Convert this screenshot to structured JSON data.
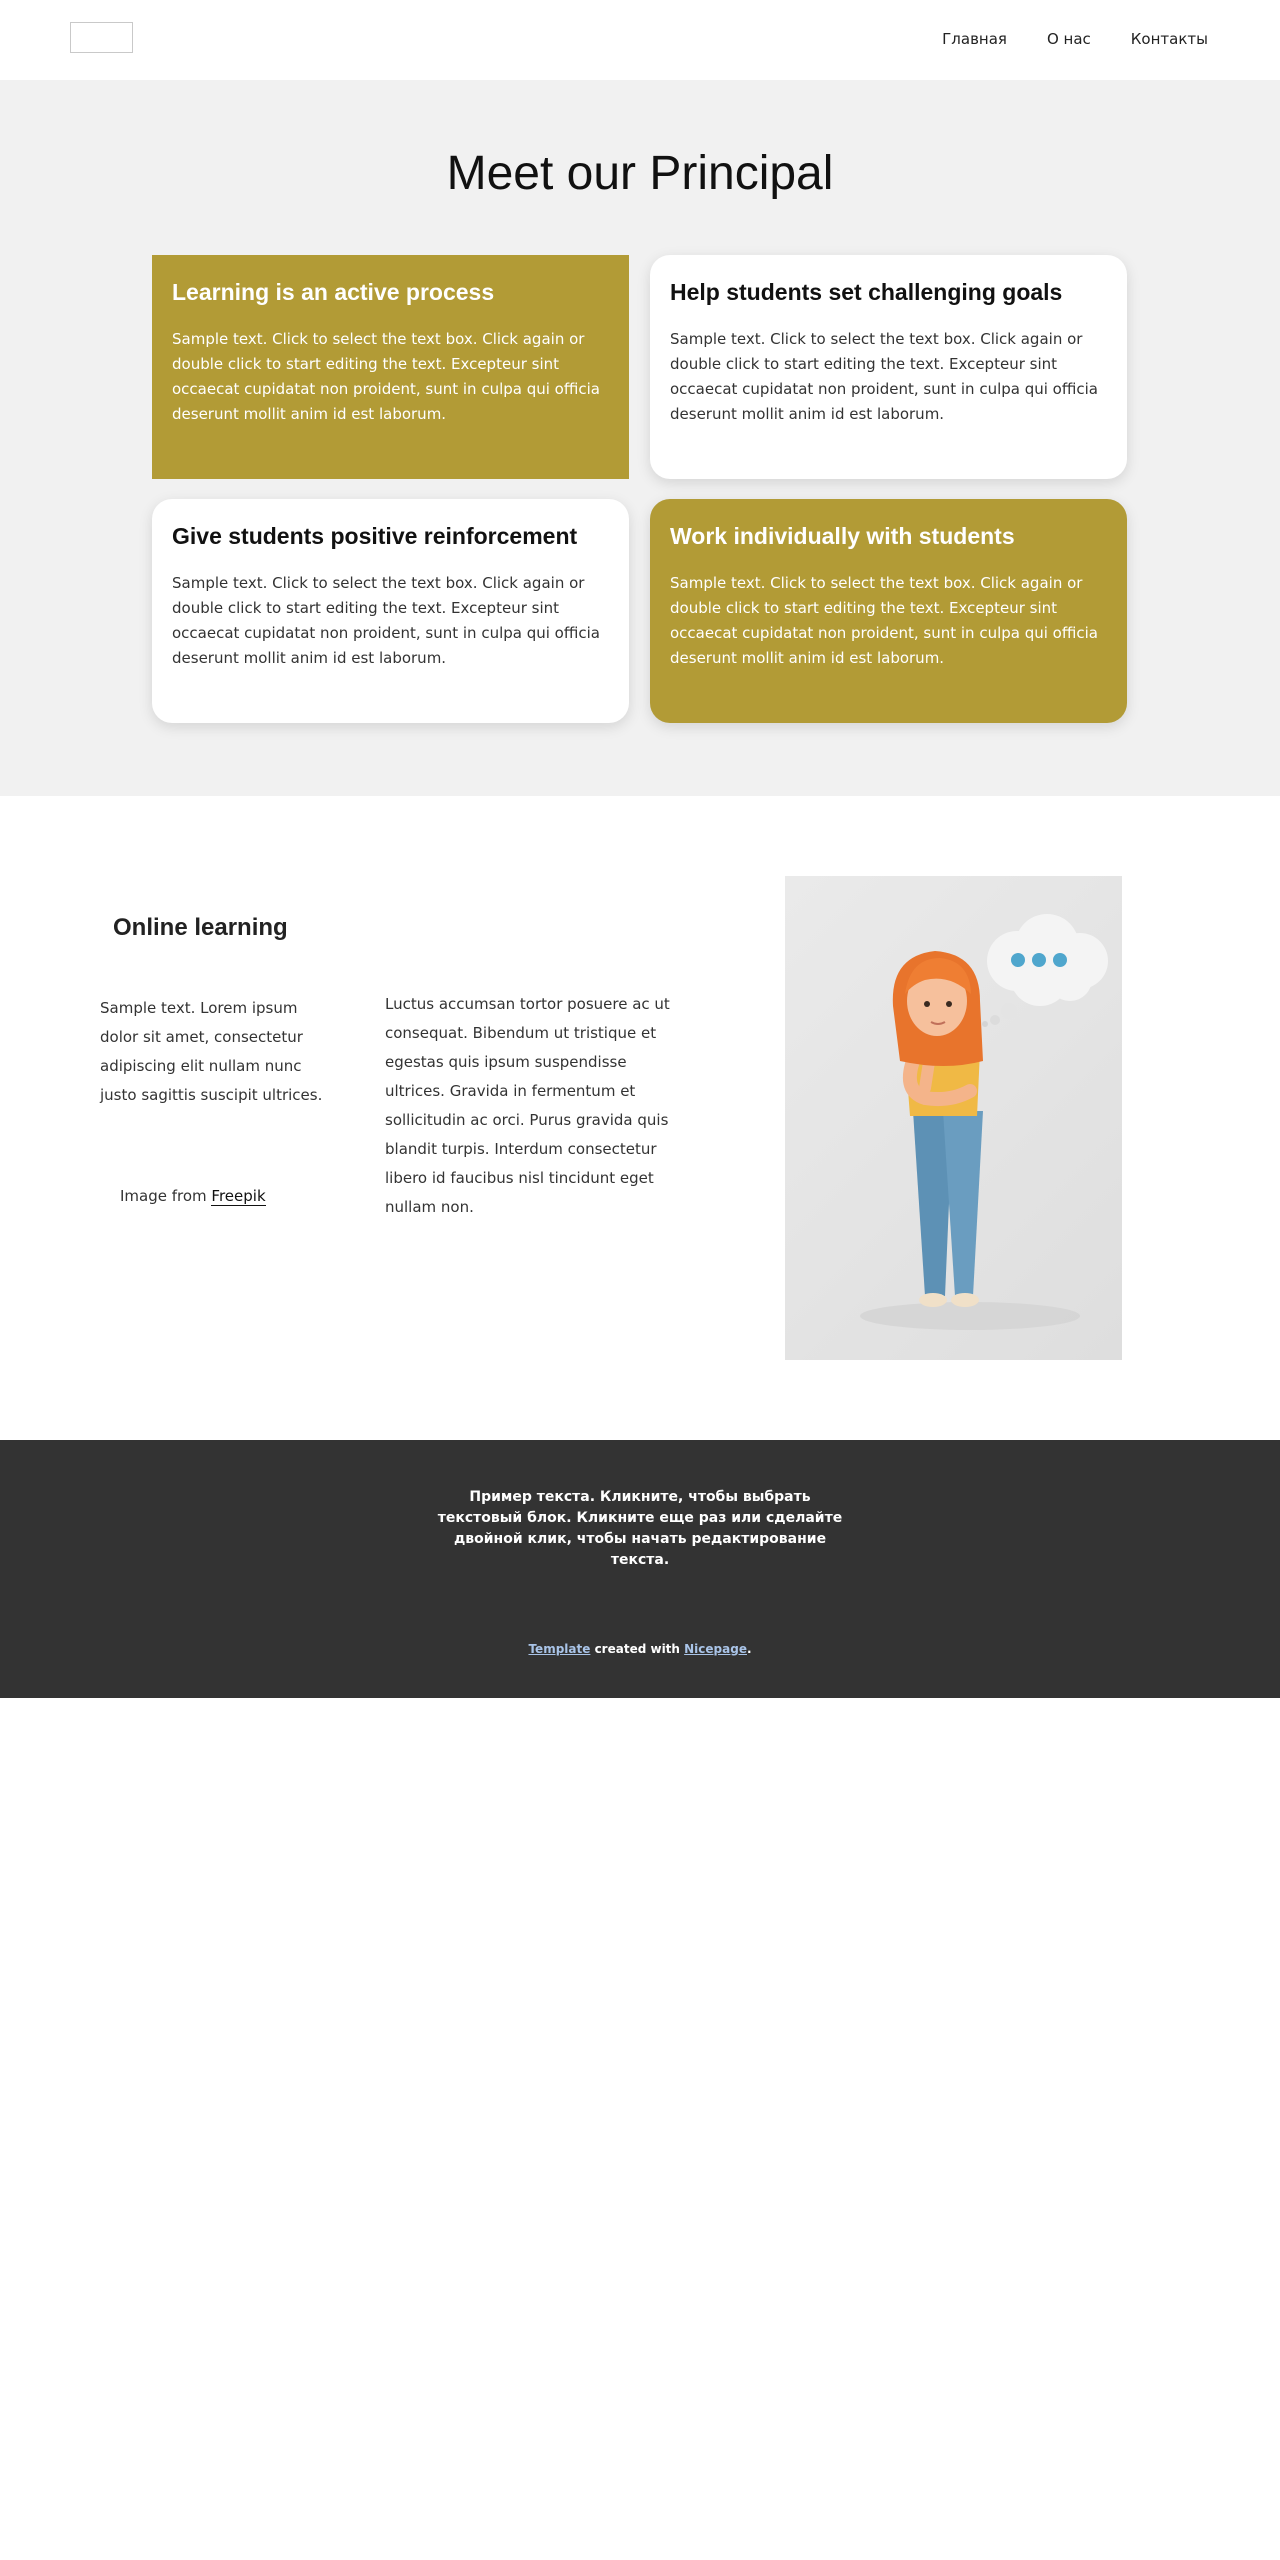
{
  "nav": {
    "items": [
      "Главная",
      "О нас",
      "Контакты"
    ]
  },
  "principal": {
    "title": "Meet our Principal",
    "cards": [
      {
        "title": "Learning is an active process",
        "text": "Sample text. Click to select the text box. Click again or double click to start editing the text. Excepteur sint occaecat cupidatat non proident, sunt in culpa qui officia deserunt mollit anim id est laborum."
      },
      {
        "title": "Help students set challenging goals",
        "text": "Sample text. Click to select the text box. Click again or double click to start editing the text. Excepteur sint occaecat cupidatat non proident, sunt in culpa qui officia deserunt mollit anim id est laborum."
      },
      {
        "title": "Give students positive reinforcement",
        "text": "Sample text. Click to select the text box. Click again or double click to start editing the text. Excepteur sint occaecat cupidatat non proident, sunt in culpa qui officia deserunt mollit anim id est laborum."
      },
      {
        "title": "Work individually with students",
        "text": "Sample text. Click to select the text box. Click again or double click to start editing the text. Excepteur sint occaecat cupidatat non proident, sunt in culpa qui officia deserunt mollit anim id est laborum."
      }
    ]
  },
  "online": {
    "title": "Online learning",
    "text_left": "Sample text. Lorem ipsum dolor sit amet, consectetur adipiscing elit nullam nunc justo sagittis suscipit ultrices.",
    "credit_prefix": "Image from ",
    "credit_link": "Freepik",
    "text_right": "Luctus accumsan tortor posuere ac ut consequat. Bibendum ut tristique et egestas quis ipsum suspendisse ultrices. Gravida in fermentum et sollicitudin ac orci. Purus gravida quis blandit turpis. Interdum consectetur libero id faucibus nisl tincidunt eget nullam non."
  },
  "footer": {
    "text": "Пример текста. Кликните, чтобы выбрать текстовый блок. Кликните еще раз или сделайте двойной клик, чтобы начать редактирование текста.",
    "credit_link1": "Template",
    "credit_mid": " created with ",
    "credit_link2": "Nicepage",
    "credit_end": "."
  },
  "colors": {
    "gold": "#b29b36",
    "section_bg": "#f1f1f1",
    "footer_bg": "#333333",
    "footer_link": "#a9c4e8"
  }
}
